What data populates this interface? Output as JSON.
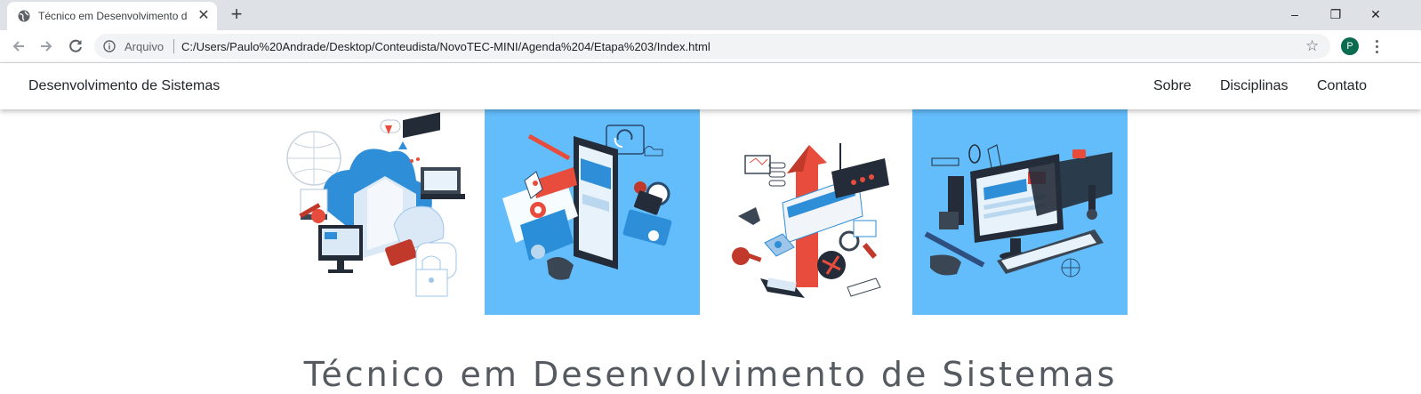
{
  "browser": {
    "tab_title": "Técnico em Desenvolvimento de",
    "tab_close": "✕",
    "new_tab": "+",
    "window_controls": {
      "minimize": "–",
      "restore": "❐",
      "close": "✕"
    },
    "omnibox": {
      "security_label": "Arquivo",
      "url": "C:/Users/Paulo%20Andrade/Desktop/Conteudista/NovoTEC-MINI/Agenda%204/Etapa%203/Index.html"
    },
    "profile_initial": "P",
    "icons": [
      "globe-icon",
      "back-arrow-icon",
      "forward-arrow-icon",
      "reload-icon",
      "info-icon",
      "star-icon",
      "kebab-menu-icon"
    ]
  },
  "page": {
    "brand": "Desenvolvimento de Sistemas",
    "nav": [
      "Sobre",
      "Disciplinas",
      "Contato"
    ],
    "images": [
      {
        "name": "cloud-network-illustration",
        "background": "#ffffff"
      },
      {
        "name": "mobile-app-illustration",
        "background": "#63bdfb"
      },
      {
        "name": "data-growth-illustration",
        "background": "#ffffff"
      },
      {
        "name": "desktop-workstation-illustration",
        "background": "#63bdfb"
      }
    ],
    "title": "Técnico em Desenvolvimento de Sistemas"
  },
  "colors": {
    "accent_blue": "#63bdfb",
    "profile_green": "#0b6b4f",
    "title_gray": "#555a60"
  }
}
